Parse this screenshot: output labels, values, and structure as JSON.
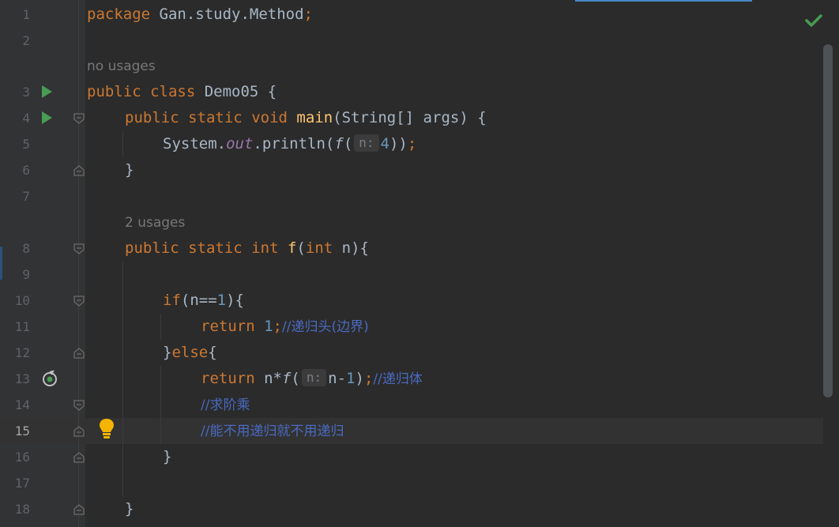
{
  "editor": {
    "line_numbers": [
      "1",
      "2",
      "3",
      "4",
      "5",
      "6",
      "7",
      "8",
      "9",
      "10",
      "11",
      "12",
      "13",
      "14",
      "15",
      "16",
      "17",
      "18"
    ],
    "current_line": "15",
    "usages": {
      "class_usages": "no usages",
      "method_usages": "2 usages"
    },
    "code": {
      "l1": {
        "kw": "package",
        "text": " Gan.study.Method",
        "semi": ";"
      },
      "l3": {
        "kw1": "public",
        "kw2": "class",
        "name": " Demo05 {"
      },
      "l4": {
        "kw1": "public",
        "kw2": "static",
        "kw3": "void",
        "fn": "main",
        "rest": "(String[] args) {"
      },
      "l5": {
        "a": "System.",
        "b": "out",
        "c": ".println(",
        "d": "f",
        "e": "(",
        "hint": "n:",
        "num": "4",
        "f": "))",
        "semi": ";"
      },
      "l6": "}",
      "l8": {
        "kw1": "public",
        "kw2": "static",
        "kw3": "int",
        "fn": "f",
        "p1": "(",
        "kw4": "int",
        "rest": " n){"
      },
      "l10": {
        "kw": "if",
        "rest1": "(n==",
        "num": "1",
        "rest2": "){"
      },
      "l11": {
        "kw": "return",
        "num": " 1",
        "semi": ";",
        "comment": "//递归头(边界)"
      },
      "l12": {
        "a": "}",
        "kw": "else",
        "b": "{"
      },
      "l13": {
        "kw": "return",
        "a": " n*",
        "fn": "f",
        "b": "(",
        "hint": "n:",
        "c": "n-",
        "num": "1",
        "d": ")",
        "semi": ";",
        "comment": "//递归体"
      },
      "l14": {
        "comment": "//求阶乘"
      },
      "l15": {
        "comment": "//能不用递归就不用递归"
      },
      "l16": "}",
      "l18": "}"
    }
  },
  "icons": {
    "run": "run-icon",
    "fold": "fold-icon",
    "recursion": "recursive-call-icon",
    "intention": "lightbulb-icon",
    "status": "checkmark-icon"
  },
  "colors": {
    "background": "#2b2b2b",
    "keyword": "#cc7832",
    "function": "#ffc66d",
    "number": "#6897bb",
    "comment": "#4a6ac0",
    "static_field": "#9876aa",
    "run_green": "#499c54",
    "check_green": "#499c54"
  }
}
